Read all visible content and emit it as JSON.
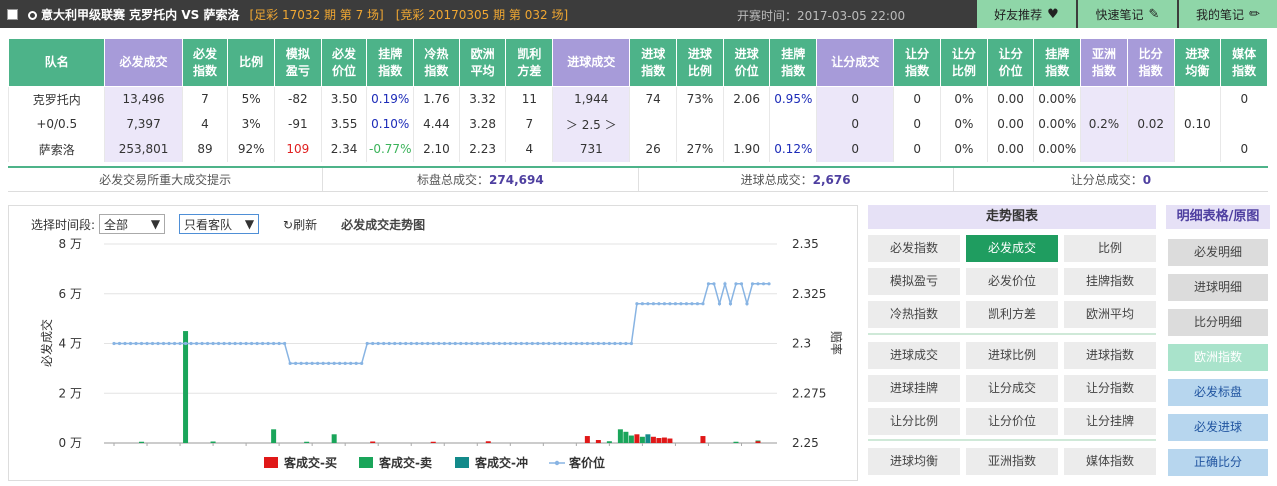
{
  "header": {
    "match_title": "意大利甲级联赛  克罗托内  VS 萨索洛",
    "zucai": "[足彩 17032 期 第 7 场]",
    "jingcai": "[竞彩 20170305 期 第 032 场]",
    "time": "开赛时间：2017-03-05 22:00",
    "btn_recommend": "好友推荐",
    "btn_quicknote": "快速笔记",
    "btn_mynote": "我的笔记"
  },
  "table": {
    "headers": [
      [
        "队名",
        ""
      ],
      [
        "必发成交",
        ""
      ],
      [
        "必发",
        "指数"
      ],
      [
        "比例",
        ""
      ],
      [
        "模拟",
        "盈亏"
      ],
      [
        "必发",
        "价位"
      ],
      [
        "挂牌",
        "指数"
      ],
      [
        "冷热",
        "指数"
      ],
      [
        "欧洲",
        "平均"
      ],
      [
        "凯利",
        "方差"
      ],
      [
        "进球成交",
        ""
      ],
      [
        "进球",
        "指数"
      ],
      [
        "进球",
        "比例"
      ],
      [
        "进球",
        "价位"
      ],
      [
        "挂牌",
        "指数"
      ],
      [
        "让分成交",
        ""
      ],
      [
        "让分",
        "指数"
      ],
      [
        "让分",
        "比例"
      ],
      [
        "让分",
        "价位"
      ],
      [
        "挂牌",
        "指数"
      ],
      [
        "亚洲",
        "指数"
      ],
      [
        "比分",
        "指数"
      ],
      [
        "进球",
        "均衡"
      ],
      [
        "媒体",
        "指数"
      ]
    ],
    "rows": [
      [
        "克罗托内",
        "13,496",
        "7",
        "5%",
        "-82",
        "3.50",
        "0.19%",
        "1.76",
        "3.32",
        "11",
        "1,944",
        "74",
        "73%",
        "2.06",
        "0.95%",
        "0",
        "0",
        "0%",
        "0.00",
        "0.00%",
        "",
        "",
        "",
        "0"
      ],
      [
        "+0/0.5",
        "7,397",
        "4",
        "3%",
        "-91",
        "3.55",
        "0.10%",
        "4.44",
        "3.28",
        "7",
        "＞ 2.5 ＞",
        "",
        "",
        "",
        "",
        "0",
        "0",
        "0%",
        "0.00",
        "0.00%",
        "0.2%",
        "0.02",
        "0.10",
        ""
      ],
      [
        "萨索洛",
        "253,801",
        "89",
        "92%",
        "109",
        "2.34",
        "-0.77%",
        "2.10",
        "2.23",
        "4",
        "731",
        "26",
        "27%",
        "1.90",
        "0.12%",
        "0",
        "0",
        "0%",
        "0.00",
        "0.00%",
        "",
        "",
        "",
        "0"
      ]
    ]
  },
  "summary": {
    "s1": "必发交易所重大成交提示",
    "s2_label": "标盘总成交：",
    "s2_value": "274,694",
    "s3_label": "进球总成交：",
    "s3_value": "2,676",
    "s4_label": "让分总成交：",
    "s4_value": "0"
  },
  "controls": {
    "time_label": "选择时间段:",
    "time_value": "全部",
    "team_value": "只看客队",
    "refresh": "刷新",
    "chart_title": "必发成交走势图"
  },
  "chart_data": {
    "type": "bar+line",
    "ylabel_left": "必发成交",
    "ylabel_right": "赔率",
    "yticks_left": [
      "8 万",
      "6 万",
      "4 万",
      "2 万",
      "0 万"
    ],
    "yticks_right": [
      "2.35",
      "2.325",
      "2.3",
      "2.275",
      "2.25"
    ],
    "ylim_left": [
      0,
      80000
    ],
    "ylim_right": [
      2.25,
      2.35
    ],
    "legend": [
      "客成交-买",
      "客成交-卖",
      "客成交-冲",
      "客价位"
    ],
    "colors": {
      "buy": "#e01818",
      "sell": "#1aa55a",
      "hedge": "#138a8a",
      "price": "#88b4e3"
    },
    "n": 120,
    "buy": [
      {
        "i": 47,
        "v": 600
      },
      {
        "i": 58,
        "v": 500
      },
      {
        "i": 68,
        "v": 700
      },
      {
        "i": 86,
        "v": 2800
      },
      {
        "i": 88,
        "v": 1200
      },
      {
        "i": 95,
        "v": 3500
      },
      {
        "i": 98,
        "v": 2500
      },
      {
        "i": 99,
        "v": 2000
      },
      {
        "i": 100,
        "v": 2200
      },
      {
        "i": 101,
        "v": 1800
      },
      {
        "i": 107,
        "v": 2800
      },
      {
        "i": 117,
        "v": 700
      }
    ],
    "sell": [
      {
        "i": 5,
        "v": 500
      },
      {
        "i": 13,
        "v": 45000
      },
      {
        "i": 18,
        "v": 600
      },
      {
        "i": 29,
        "v": 5500
      },
      {
        "i": 35,
        "v": 500
      },
      {
        "i": 40,
        "v": 3500
      },
      {
        "i": 90,
        "v": 700
      },
      {
        "i": 92,
        "v": 5500
      },
      {
        "i": 93,
        "v": 4500
      },
      {
        "i": 94,
        "v": 3000
      },
      {
        "i": 96,
        "v": 2500
      },
      {
        "i": 113,
        "v": 500
      },
      {
        "i": 117,
        "v": 1000
      }
    ],
    "hedge": [
      {
        "i": 97,
        "v": 3500
      }
    ],
    "price": [
      2.3,
      2.3,
      2.3,
      2.3,
      2.3,
      2.3,
      2.3,
      2.3,
      2.3,
      2.3,
      2.3,
      2.3,
      2.3,
      2.3,
      2.3,
      2.3,
      2.3,
      2.3,
      2.3,
      2.3,
      2.3,
      2.3,
      2.3,
      2.3,
      2.3,
      2.3,
      2.3,
      2.3,
      2.3,
      2.3,
      2.3,
      2.3,
      2.29,
      2.29,
      2.29,
      2.29,
      2.29,
      2.29,
      2.29,
      2.29,
      2.29,
      2.29,
      2.29,
      2.29,
      2.29,
      2.29,
      2.3,
      2.3,
      2.3,
      2.3,
      2.3,
      2.3,
      2.3,
      2.3,
      2.3,
      2.3,
      2.3,
      2.3,
      2.3,
      2.3,
      2.3,
      2.3,
      2.3,
      2.3,
      2.3,
      2.3,
      2.3,
      2.3,
      2.3,
      2.3,
      2.3,
      2.3,
      2.3,
      2.3,
      2.3,
      2.3,
      2.3,
      2.3,
      2.3,
      2.3,
      2.3,
      2.3,
      2.3,
      2.3,
      2.3,
      2.3,
      2.3,
      2.3,
      2.3,
      2.3,
      2.3,
      2.3,
      2.3,
      2.3,
      2.3,
      2.32,
      2.32,
      2.32,
      2.32,
      2.32,
      2.32,
      2.32,
      2.32,
      2.32,
      2.32,
      2.32,
      2.32,
      2.32,
      2.33,
      2.33,
      2.32,
      2.33,
      2.32,
      2.33,
      2.33,
      2.32,
      2.33,
      2.33,
      2.33,
      2.33
    ]
  },
  "panel": {
    "title": "走势图表",
    "items": [
      "必发指数",
      "必发成交",
      "比例",
      "模拟盈亏",
      "必发价位",
      "挂牌指数",
      "冷热指数",
      "凯利方差",
      "欧洲平均",
      "进球成交",
      "进球比例",
      "进球指数",
      "进球挂牌",
      "让分成交",
      "让分指数",
      "让分比例",
      "让分价位",
      "让分挂牌",
      "进球均衡",
      "亚洲指数",
      "媒体指数"
    ],
    "active": "必发成交"
  },
  "side": {
    "title": "明细表格/原图",
    "items": [
      "必发明细",
      "进球明细",
      "比分明细",
      "欧洲指数",
      "必发标盘",
      "必发进球",
      "正确比分"
    ]
  }
}
